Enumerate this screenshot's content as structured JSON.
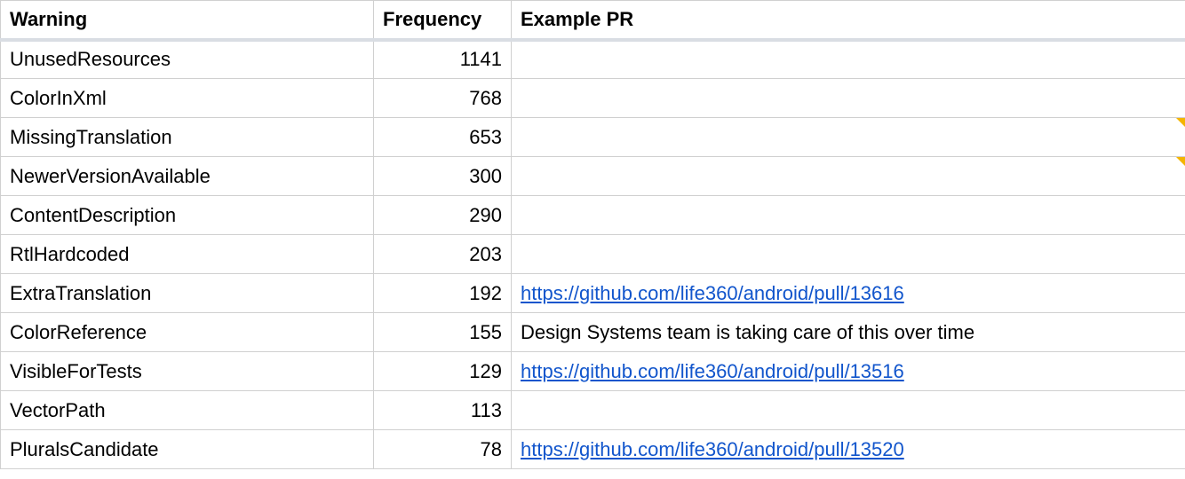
{
  "headers": {
    "warning": "Warning",
    "frequency": "Frequency",
    "example_pr": "Example PR"
  },
  "rows": [
    {
      "warning": "UnusedResources",
      "frequency": 1141,
      "example": "",
      "example_is_link": false,
      "has_note": false
    },
    {
      "warning": "ColorInXml",
      "frequency": 768,
      "example": "",
      "example_is_link": false,
      "has_note": false
    },
    {
      "warning": "MissingTranslation",
      "frequency": 653,
      "example": "",
      "example_is_link": false,
      "has_note": true
    },
    {
      "warning": "NewerVersionAvailable",
      "frequency": 300,
      "example": "",
      "example_is_link": false,
      "has_note": true
    },
    {
      "warning": "ContentDescription",
      "frequency": 290,
      "example": "",
      "example_is_link": false,
      "has_note": false
    },
    {
      "warning": "RtlHardcoded",
      "frequency": 203,
      "example": "",
      "example_is_link": false,
      "has_note": false
    },
    {
      "warning": "ExtraTranslation",
      "frequency": 192,
      "example": "https://github.com/life360/android/pull/13616",
      "example_is_link": true,
      "has_note": false
    },
    {
      "warning": "ColorReference",
      "frequency": 155,
      "example": "Design Systems team is taking care of this over time",
      "example_is_link": false,
      "has_note": false
    },
    {
      "warning": "VisibleForTests",
      "frequency": 129,
      "example": "https://github.com/life360/android/pull/13516",
      "example_is_link": true,
      "has_note": false
    },
    {
      "warning": "VectorPath",
      "frequency": 113,
      "example": "",
      "example_is_link": false,
      "has_note": false
    },
    {
      "warning": "PluralsCandidate",
      "frequency": 78,
      "example": "https://github.com/life360/android/pull/13520",
      "example_is_link": true,
      "has_note": false
    }
  ]
}
